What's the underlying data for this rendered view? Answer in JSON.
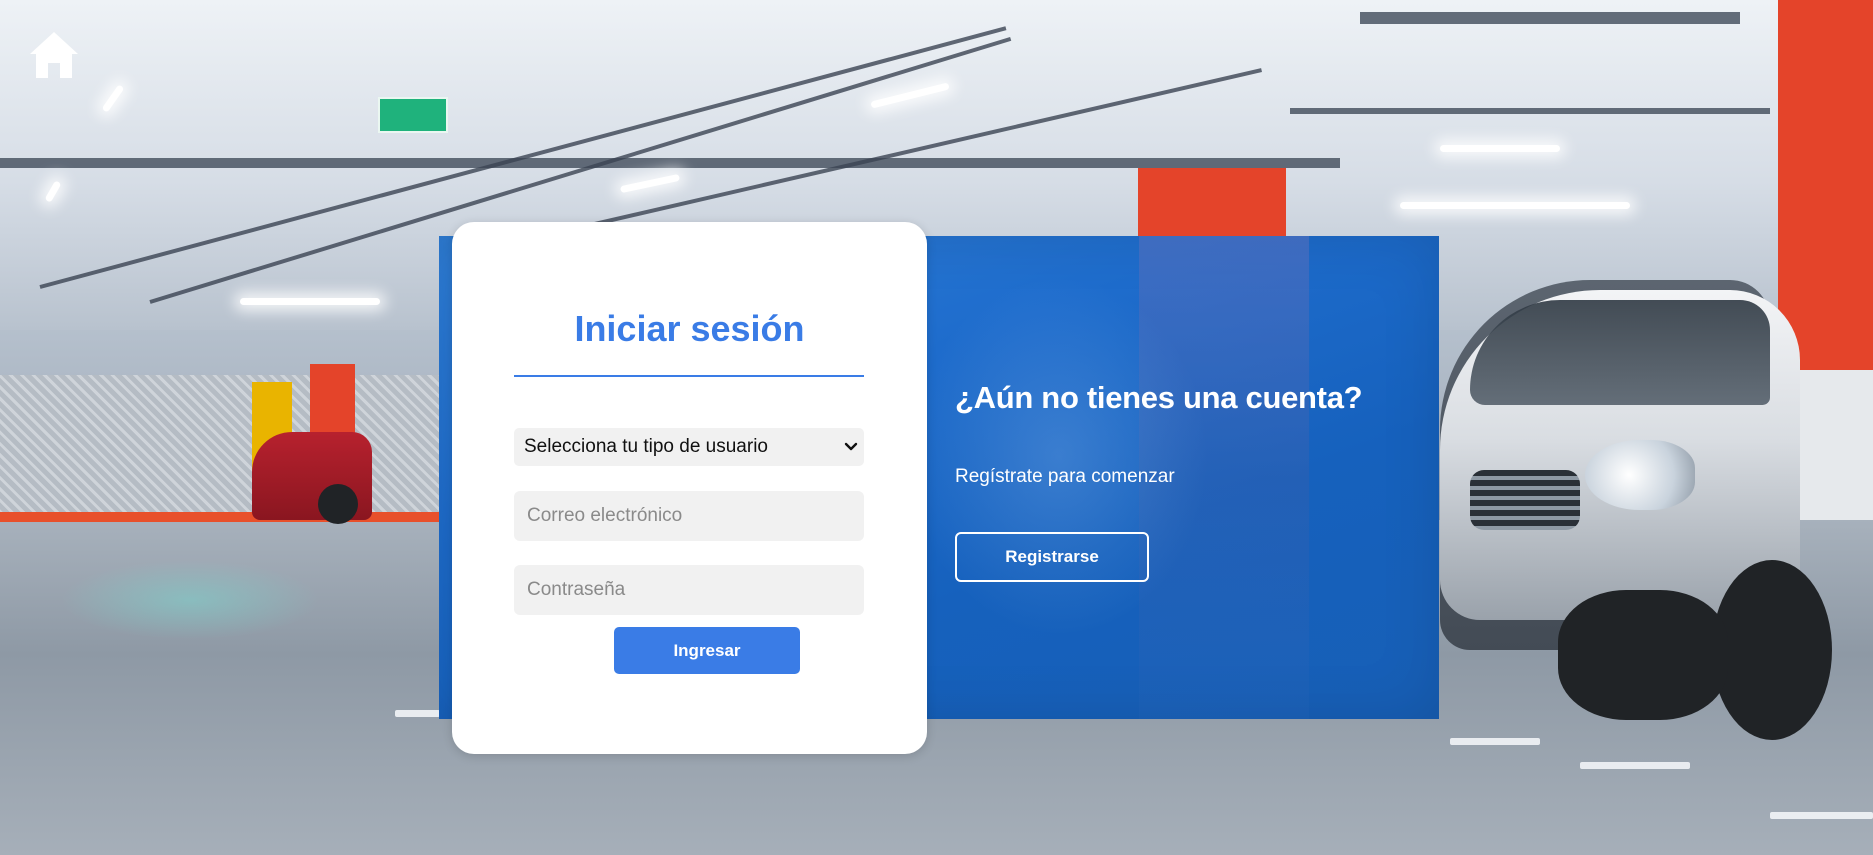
{
  "nav": {
    "home_icon": "home-icon"
  },
  "login": {
    "title": "Iniciar sesión",
    "user_type_select": {
      "selected": "Selecciona tu tipo de usuario"
    },
    "email_placeholder": "Correo electrónico",
    "password_placeholder": "Contraseña",
    "submit_label": "Ingresar"
  },
  "signup_prompt": {
    "heading": "¿Aún no tienes una cuenta?",
    "subtext": "Regístrate para comenzar",
    "register_label": "Registrarse"
  },
  "colors": {
    "accent_blue": "#3a7ce6",
    "promo_blue": "#1e6ccc",
    "card_background": "#ffffff",
    "input_background": "#f1f1f1"
  }
}
